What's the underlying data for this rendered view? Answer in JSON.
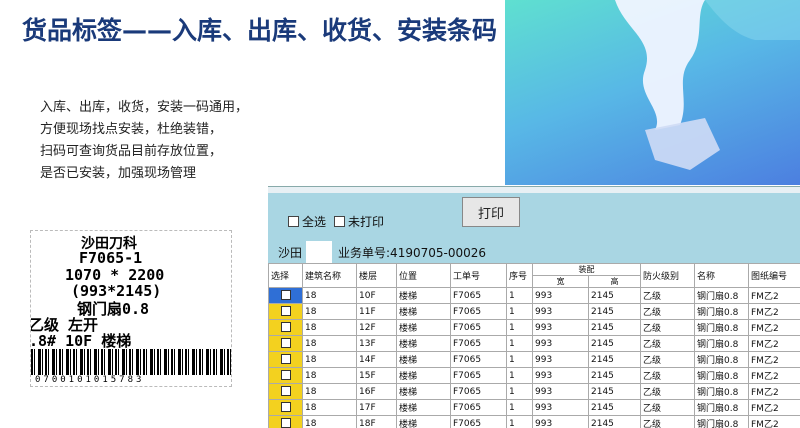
{
  "slide": {
    "title": "货品标签——入库、出库、收货、安装条码",
    "desc": [
      "入库、出库，收货，安装一码通用，",
      "方便现场找点安装，杜绝装错，",
      "扫码可查询货品目前存放位置，",
      "是否已安装，加强现场管理"
    ]
  },
  "label": {
    "line1": "沙田刀科",
    "line2": "F7065-1",
    "line3": "1070 * 2200",
    "line4": "(993*2145)",
    "line5": "钢门扇0.8",
    "line6": "乙级 左开",
    "line7": ".8# 10F 楼梯",
    "barcode_digits": "0700101015783"
  },
  "app": {
    "select_all": "全选",
    "unprinted": "未打印",
    "print_button": "打印",
    "site_label": "沙田",
    "order_no": "业务单号:4190705-00026",
    "columns": [
      "选择",
      "建筑名称",
      "楼层",
      "位置",
      "工单号",
      "序号",
      "装配",
      "防火级别",
      "名称",
      "图纸编号"
    ],
    "sub_columns": [
      "宽",
      "高"
    ],
    "rows": [
      {
        "building": "18",
        "floor": "10F",
        "pos": "楼梯",
        "order": "F7065",
        "seq": "1",
        "w": "993",
        "h": "2145",
        "fire": "乙级",
        "name": "钢门扇0.8",
        "drawing": "FM乙2"
      },
      {
        "building": "18",
        "floor": "11F",
        "pos": "楼梯",
        "order": "F7065",
        "seq": "1",
        "w": "993",
        "h": "2145",
        "fire": "乙级",
        "name": "钢门扇0.8",
        "drawing": "FM乙2"
      },
      {
        "building": "18",
        "floor": "12F",
        "pos": "楼梯",
        "order": "F7065",
        "seq": "1",
        "w": "993",
        "h": "2145",
        "fire": "乙级",
        "name": "钢门扇0.8",
        "drawing": "FM乙2"
      },
      {
        "building": "18",
        "floor": "13F",
        "pos": "楼梯",
        "order": "F7065",
        "seq": "1",
        "w": "993",
        "h": "2145",
        "fire": "乙级",
        "name": "钢门扇0.8",
        "drawing": "FM乙2"
      },
      {
        "building": "18",
        "floor": "14F",
        "pos": "楼梯",
        "order": "F7065",
        "seq": "1",
        "w": "993",
        "h": "2145",
        "fire": "乙级",
        "name": "钢门扇0.8",
        "drawing": "FM乙2"
      },
      {
        "building": "18",
        "floor": "15F",
        "pos": "楼梯",
        "order": "F7065",
        "seq": "1",
        "w": "993",
        "h": "2145",
        "fire": "乙级",
        "name": "钢门扇0.8",
        "drawing": "FM乙2"
      },
      {
        "building": "18",
        "floor": "16F",
        "pos": "楼梯",
        "order": "F7065",
        "seq": "1",
        "w": "993",
        "h": "2145",
        "fire": "乙级",
        "name": "钢门扇0.8",
        "drawing": "FM乙2"
      },
      {
        "building": "18",
        "floor": "17F",
        "pos": "楼梯",
        "order": "F7065",
        "seq": "1",
        "w": "993",
        "h": "2145",
        "fire": "乙级",
        "name": "钢门扇0.8",
        "drawing": "FM乙2"
      },
      {
        "building": "18",
        "floor": "18F",
        "pos": "楼梯",
        "order": "F7065",
        "seq": "1",
        "w": "993",
        "h": "2145",
        "fire": "乙级",
        "name": "钢门扇0.8",
        "drawing": "FM乙2"
      }
    ]
  }
}
